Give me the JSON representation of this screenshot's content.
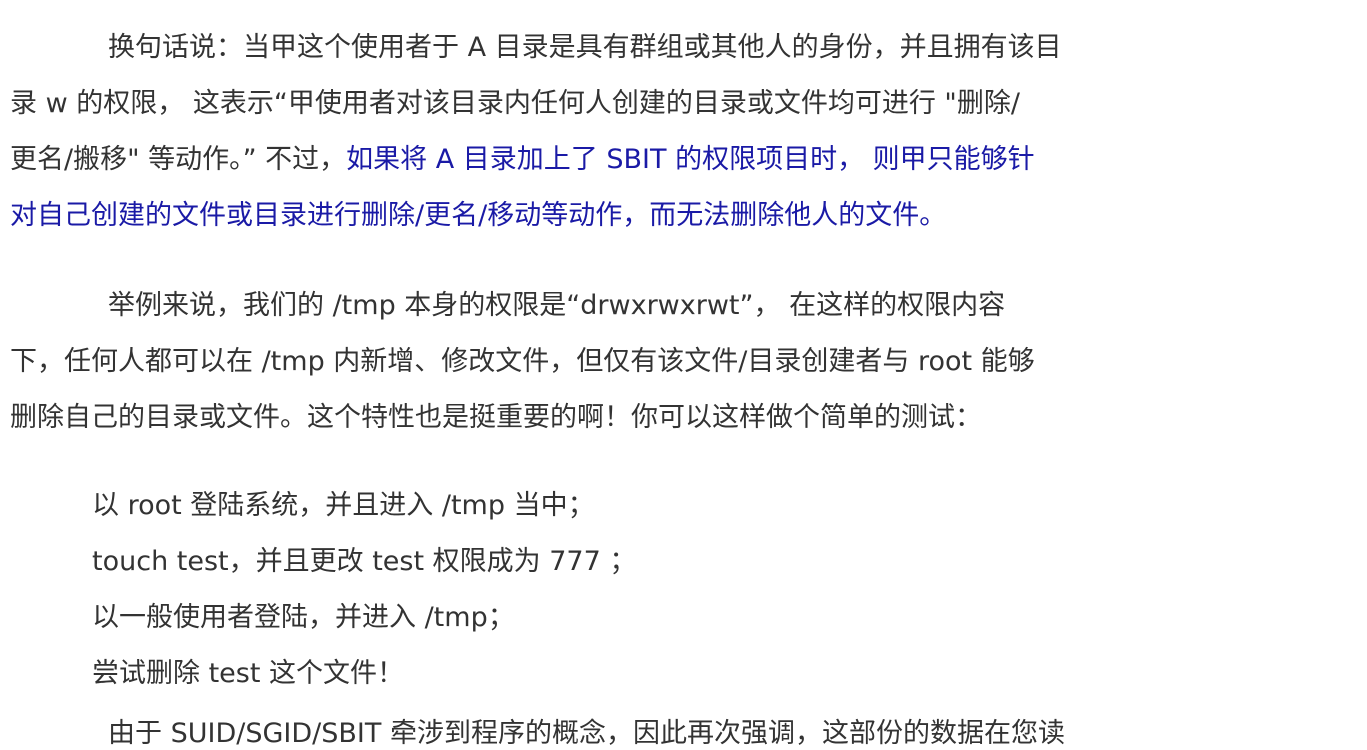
{
  "paragraph1": {
    "line1": "换句话说：当甲这个使用者于 A 目录是具有群组或其他人的身份，并且拥有该目",
    "line2": "录 w 的权限， 这表示“甲使用者对该目录内任何人创建的目录或文件均可进行 \"删除/",
    "line3_plain": "更名/搬移\" 等动作。” 不过，",
    "line3_highlight": "如果将 A 目录加上了 SBIT 的权限项目时， 则甲只能够针",
    "line4_highlight": "对自己创建的文件或目录进行删除/更名/移动等动作，而无法删除他人的文件。"
  },
  "paragraph2": {
    "line1": "举例来说，我们的 /tmp 本身的权限是“drwxrwxrwt”， 在这样的权限内容",
    "line2": "下，任何人都可以在 /tmp 内新增、修改文件，但仅有该文件/目录创建者与 root 能够",
    "line3": "删除自己的目录或文件。这个特性也是挺重要的啊！你可以这样做个简单的测试："
  },
  "steps": [
    "以 root 登陆系统，并且进入 /tmp 当中；",
    "touch test，并且更改 test 权限成为 777 ；",
    "以一般使用者登陆，并进入 /tmp；",
    "尝试删除 test 这个文件！"
  ],
  "paragraph3": {
    "line1_partial": "由于 SUID/SGID/SBIT 牵涉到程序的概念，因此再次强调，这部份的数据在您读"
  },
  "colors": {
    "text": "#333333",
    "highlight": "#1a1aa6",
    "background": "#ffffff"
  }
}
